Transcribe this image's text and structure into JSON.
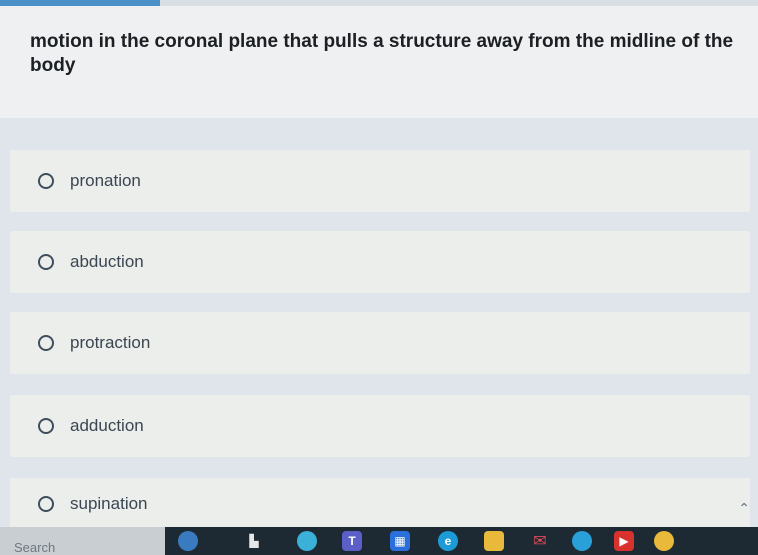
{
  "question": {
    "text": "motion in the coronal plane that pulls a structure away from the midline of the body"
  },
  "choices": [
    {
      "label": "pronation",
      "selected": false
    },
    {
      "label": "abduction",
      "selected": false
    },
    {
      "label": "protraction",
      "selected": false
    },
    {
      "label": "adduction",
      "selected": false
    },
    {
      "label": "supination",
      "selected": false
    }
  ],
  "taskbar": {
    "search_label": "Search",
    "icons": [
      "widgets-icon",
      "file-explorer-icon",
      "copilot-icon",
      "teams-icon",
      "store-icon",
      "edge-icon",
      "folder-icon",
      "mail-icon",
      "app-icon",
      "media-icon",
      "chrome-icon"
    ]
  },
  "colors": {
    "accent": "#4a90c8",
    "taskbar": "#1d2a34"
  }
}
